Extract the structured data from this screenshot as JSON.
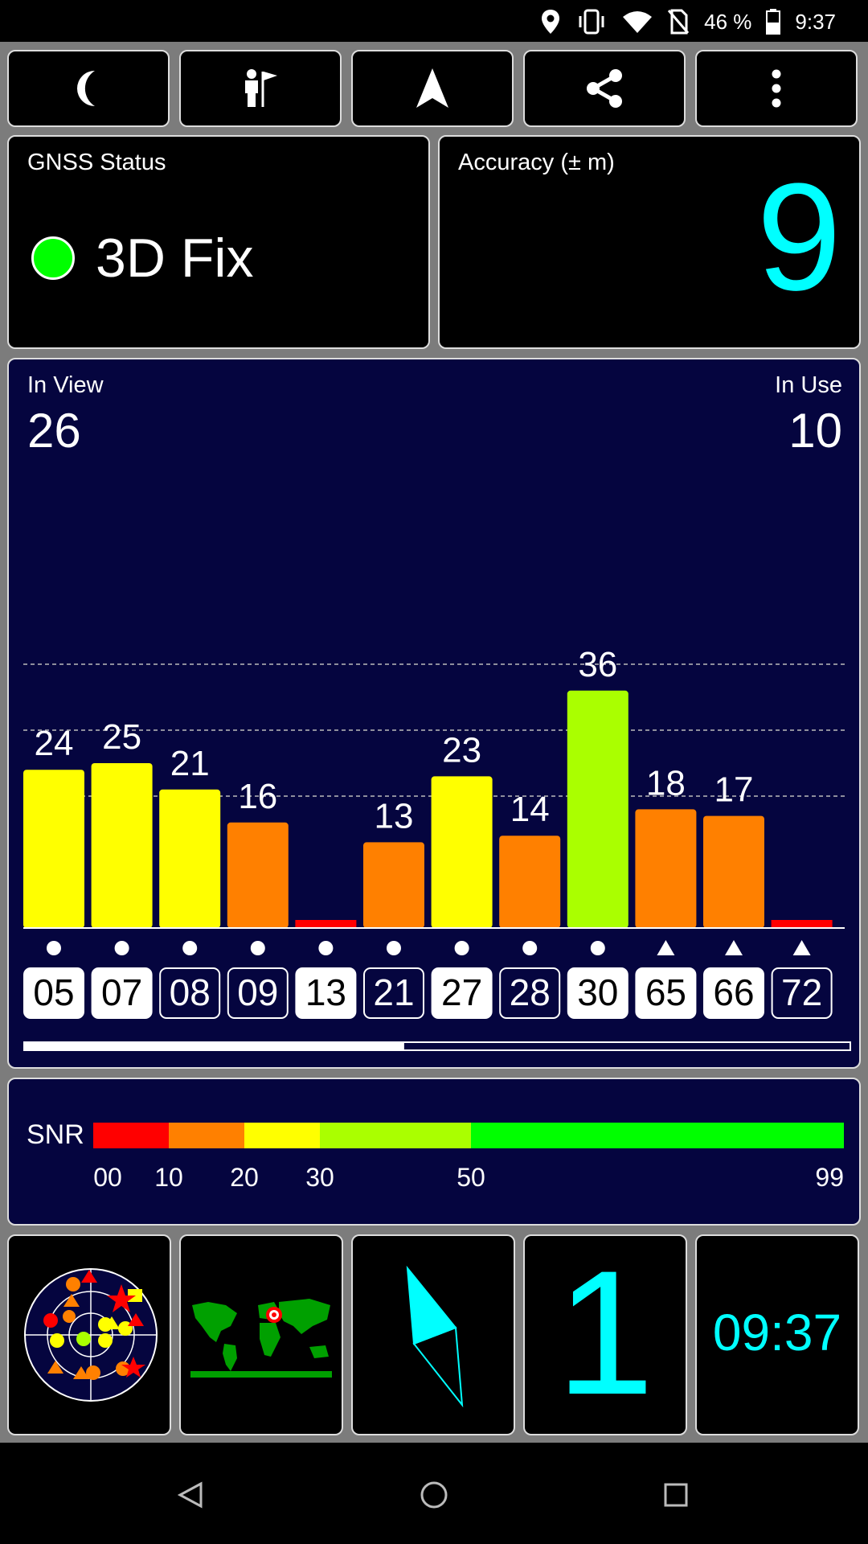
{
  "status_bar": {
    "battery": "46 %",
    "time": "9:37",
    "icons": [
      "location-icon",
      "vibrate-icon",
      "wifi-icon",
      "no-sim-icon",
      "battery-icon"
    ]
  },
  "toolbar": {
    "buttons": [
      "night-mode-icon",
      "person-flag-icon",
      "navigation-arrow-icon",
      "share-icon",
      "more-vert-icon"
    ]
  },
  "gnss": {
    "label": "GNSS Status",
    "value": "3D Fix",
    "indicator_color": "#00ff00"
  },
  "accuracy": {
    "label": "Accuracy (± m)",
    "value": "9"
  },
  "satellites": {
    "in_view_label": "In View",
    "in_view": "26",
    "in_use_label": "In Use",
    "in_use": "10"
  },
  "chart_data": {
    "type": "bar",
    "categories": [
      "05",
      "07",
      "08",
      "09",
      "13",
      "21",
      "27",
      "28",
      "30",
      "65",
      "66",
      "72"
    ],
    "values": [
      24,
      25,
      21,
      16,
      0,
      13,
      23,
      14,
      36,
      18,
      17,
      0
    ],
    "value_labels": [
      "24",
      "25",
      "21",
      "16",
      "",
      "13",
      "23",
      "14",
      "36",
      "18",
      "17",
      ""
    ],
    "in_use": [
      true,
      true,
      false,
      false,
      true,
      false,
      true,
      false,
      true,
      true,
      true,
      false
    ],
    "markers": [
      "circle",
      "circle",
      "circle",
      "circle",
      "circle",
      "circle",
      "circle",
      "circle",
      "circle",
      "triangle",
      "triangle",
      "triangle"
    ],
    "colors": [
      "#ffff00",
      "#ffff00",
      "#ffff00",
      "#ff8000",
      "#ff0000",
      "#ff8000",
      "#ffff00",
      "#ff8000",
      "#aaff00",
      "#ff8000",
      "#ff8000",
      "#ff0000"
    ],
    "ylim": [
      0,
      50
    ],
    "gridlines": [
      20,
      30,
      40
    ],
    "scroll_fraction": 0.46
  },
  "snr": {
    "label": "SNR",
    "ticks": [
      "00",
      "10",
      "20",
      "30",
      "50",
      "99"
    ],
    "segments": [
      {
        "from": 0,
        "to": 10,
        "color": "#ff0000"
      },
      {
        "from": 10,
        "to": 20,
        "color": "#ff8000"
      },
      {
        "from": 20,
        "to": 30,
        "color": "#ffff00"
      },
      {
        "from": 30,
        "to": 50,
        "color": "#aaff00"
      },
      {
        "from": 50,
        "to": 99,
        "color": "#00ff00"
      }
    ]
  },
  "bottom_tiles": {
    "sky_plot": "sky-plot-icon",
    "world_map": "world-map-icon",
    "compass": "compass-icon",
    "count": "1",
    "clock": "09:37"
  },
  "nav": [
    "back-icon",
    "home-icon",
    "recents-icon"
  ]
}
